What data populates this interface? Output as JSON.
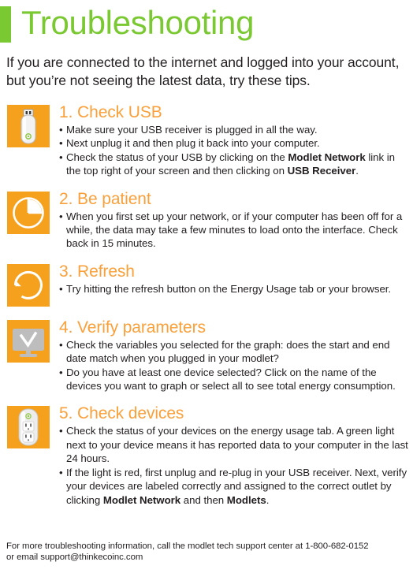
{
  "header": {
    "title": "Troubleshooting",
    "accent_color": "#7AC832"
  },
  "intro": {
    "text": "If you are connected to the internet and logged into your account, but you’re not seeing the latest data, try these tips."
  },
  "theme": {
    "tile_orange": "#F5A11E",
    "heading_orange": "#F9A03A",
    "body_text": "#231F20",
    "monitor_gray": "#BDBDBD",
    "led_green": "#8DC63F"
  },
  "sections": [
    {
      "number": "1.",
      "heading": "1. Check USB",
      "icon": "usb-stick-icon",
      "bullets": [
        [
          {
            "t": "Make sure your USB receiver is plugged in all the way.",
            "b": false
          }
        ],
        [
          {
            "t": "Next unplug it and then plug it back into your computer.",
            "b": false
          }
        ],
        [
          {
            "t": "Check the status of your USB by clicking on the ",
            "b": false
          },
          {
            "t": "Modlet Network",
            "b": true
          },
          {
            "t": " link in the top right of your screen and then clicking on ",
            "b": false
          },
          {
            "t": "USB Receiver",
            "b": true
          },
          {
            "t": ".",
            "b": false
          }
        ]
      ]
    },
    {
      "number": "2.",
      "heading": "2. Be patient",
      "icon": "clock-pie-icon",
      "bullets": [
        [
          {
            "t": "When you first set up your network, or if your computer has been off for a while, the data may take a few minutes to load onto the interface. Check back in 15 minutes.",
            "b": false
          }
        ]
      ]
    },
    {
      "number": "3.",
      "heading": "3. Refresh",
      "icon": "refresh-icon",
      "bullets": [
        [
          {
            "t": "Try hitting the refresh button on the Energy Usage tab or your browser.",
            "b": false
          }
        ]
      ]
    },
    {
      "number": "4.",
      "heading": "4. Verify parameters",
      "icon": "monitor-check-icon",
      "bullets": [
        [
          {
            "t": "Check the variables you selected for the graph: does the start and end date match when you plugged in your modlet?",
            "b": false
          }
        ],
        [
          {
            "t": "Do you have at least one device selected? Click on the name of the devices you want to graph or select all to see total energy consumption.",
            "b": false
          }
        ]
      ]
    },
    {
      "number": "5.",
      "heading": "5. Check devices",
      "icon": "modlet-outlet-icon",
      "bullets": [
        [
          {
            "t": "Check the status of your devices on the energy usage tab. A green light next to your device means it has reported data to your computer in the last 24 hours.",
            "b": false
          }
        ],
        [
          {
            "t": "If the light is red, first unplug and re-plug in your USB receiver. Next, verify your devices are labeled correctly and assigned to the correct outlet by clicking ",
            "b": false
          },
          {
            "t": "Modlet Network",
            "b": true
          },
          {
            "t": " and then ",
            "b": false
          },
          {
            "t": "Modlets",
            "b": true
          },
          {
            "t": ".",
            "b": false
          }
        ]
      ]
    }
  ],
  "footer": {
    "line1": "For more troubleshooting information, call the modlet tech support center at 1-800-682-0152",
    "line2": "or email support@thinkecoinc.com"
  }
}
